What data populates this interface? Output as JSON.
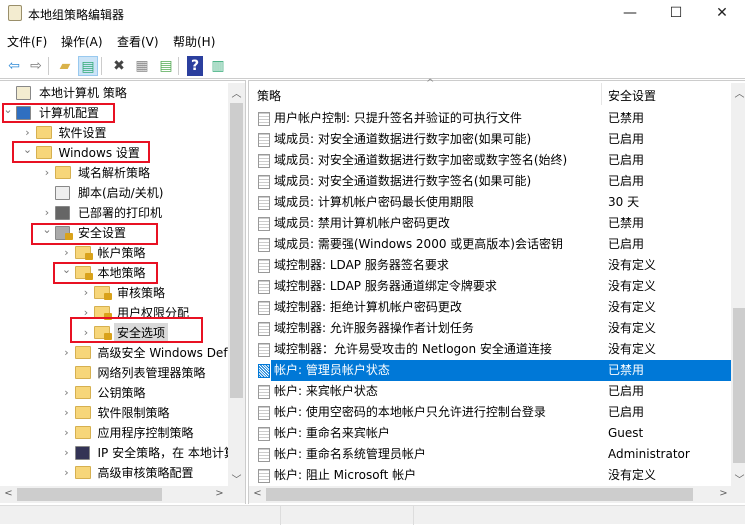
{
  "window": {
    "title": "本地组策略编辑器",
    "minimize": "—",
    "maximize": "☐",
    "close": "✕"
  },
  "menu": [
    "文件(F)",
    "操作(A)",
    "查看(V)",
    "帮助(H)"
  ],
  "toolbar": [
    {
      "name": "back-icon",
      "glyph": "⇦",
      "color": "#2d89d6"
    },
    {
      "name": "forward-icon",
      "glyph": "⇨",
      "color": "#777"
    },
    {
      "name": "up-folder-icon",
      "glyph": "▰",
      "color": "#d9b24a"
    },
    {
      "name": "show-hide-tree-icon",
      "glyph": "▤",
      "color": "#3a7"
    },
    {
      "name": "delete-icon",
      "glyph": "✖",
      "color": "#444"
    },
    {
      "name": "properties-icon",
      "glyph": "▦",
      "color": "#888"
    },
    {
      "name": "export-list-icon",
      "glyph": "▤",
      "color": "#5a5"
    },
    {
      "name": "help-icon",
      "glyph": "?",
      "color": "#fff"
    },
    {
      "name": "show-action-pane-icon",
      "glyph": "▥",
      "color": "#3a7"
    }
  ],
  "tree": [
    {
      "label": "本地计算机 策略",
      "level": 0,
      "chev": "",
      "icon": "scroll"
    },
    {
      "label": "计算机配置",
      "level": 0,
      "chev": "⌄",
      "icon": "computer",
      "hl": true
    },
    {
      "label": "软件设置",
      "level": 1,
      "chev": "›",
      "icon": "folder"
    },
    {
      "label": "Windows 设置",
      "level": 1,
      "chev": "⌄",
      "icon": "folder",
      "hl": true
    },
    {
      "label": "域名解析策略",
      "level": 2,
      "chev": "›",
      "icon": "folder"
    },
    {
      "label": "脚本(启动/关机)",
      "level": 2,
      "chev": "",
      "icon": "script"
    },
    {
      "label": "已部署的打印机",
      "level": 2,
      "chev": "›",
      "icon": "printer"
    },
    {
      "label": "安全设置",
      "level": 2,
      "chev": "⌄",
      "icon": "server-lock",
      "hl": true
    },
    {
      "label": "帐户策略",
      "level": 3,
      "chev": "›",
      "icon": "folder-lock"
    },
    {
      "label": "本地策略",
      "level": 3,
      "chev": "⌄",
      "icon": "folder-lock",
      "hl": true
    },
    {
      "label": "审核策略",
      "level": 4,
      "chev": "›",
      "icon": "folder-lock"
    },
    {
      "label": "用户权限分配",
      "level": 4,
      "chev": "›",
      "icon": "folder-lock"
    },
    {
      "label": "安全选项",
      "level": 4,
      "chev": "›",
      "icon": "folder-lock",
      "hl": true,
      "selected": true
    },
    {
      "label": "高级安全 Windows Defender 防火墙",
      "level": 3,
      "chev": "›",
      "icon": "folder"
    },
    {
      "label": "网络列表管理器策略",
      "level": 3,
      "chev": "",
      "icon": "folder"
    },
    {
      "label": "公钥策略",
      "level": 3,
      "chev": "›",
      "icon": "folder"
    },
    {
      "label": "软件限制策略",
      "level": 3,
      "chev": "›",
      "icon": "folder"
    },
    {
      "label": "应用程序控制策略",
      "level": 3,
      "chev": "›",
      "icon": "folder"
    },
    {
      "label": "IP 安全策略，在 本地计算机",
      "level": 3,
      "chev": "›",
      "icon": "ip"
    },
    {
      "label": "高级审核策略配置",
      "level": 3,
      "chev": "›",
      "icon": "folder"
    }
  ],
  "list": {
    "columns": [
      "策略",
      "安全设置"
    ],
    "rows": [
      [
        "用户帐户控制: 只提升签名并验证的可执行文件",
        "已禁用"
      ],
      [
        "域成员: 对安全通道数据进行数字加密(如果可能)",
        "已启用"
      ],
      [
        "域成员: 对安全通道数据进行数字加密或数字签名(始终)",
        "已启用"
      ],
      [
        "域成员: 对安全通道数据进行数字签名(如果可能)",
        "已启用"
      ],
      [
        "域成员: 计算机帐户密码最长使用期限",
        "30 天"
      ],
      [
        "域成员: 禁用计算机帐户密码更改",
        "已禁用"
      ],
      [
        "域成员: 需要强(Windows 2000 或更高版本)会话密钥",
        "已启用"
      ],
      [
        "域控制器: LDAP 服务器签名要求",
        "没有定义"
      ],
      [
        "域控制器: LDAP 服务器通道绑定令牌要求",
        "没有定义"
      ],
      [
        "域控制器: 拒绝计算机帐户密码更改",
        "没有定义"
      ],
      [
        "域控制器: 允许服务器操作者计划任务",
        "没有定义"
      ],
      [
        "域控制器：允许易受攻击的 Netlogon 安全通道连接",
        "没有定义"
      ],
      [
        "帐户: 管理员帐户状态",
        "已禁用"
      ],
      [
        "帐户: 来宾帐户状态",
        "已启用"
      ],
      [
        "帐户: 使用空密码的本地帐户只允许进行控制台登录",
        "已启用"
      ],
      [
        "帐户: 重命名来宾帐户",
        "Guest"
      ],
      [
        "帐户: 重命名系统管理员帐户",
        "Administrator"
      ],
      [
        "帐户: 阻止 Microsoft 帐户",
        "没有定义"
      ]
    ],
    "selected_index": 12
  },
  "colors": {
    "selection": "#0078d7",
    "highlight_box": "#e81123"
  }
}
